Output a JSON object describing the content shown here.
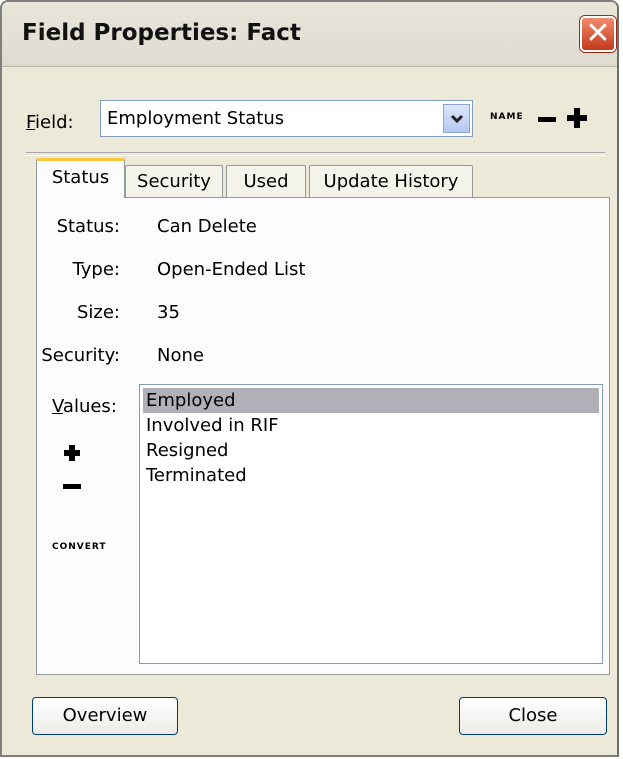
{
  "window": {
    "title": "Field Properties: Fact",
    "close_glyph": "✕"
  },
  "field": {
    "label_accel": "F",
    "label_rest": "ield:",
    "selected_value": "Employment Status",
    "name_button": "NAME",
    "remove_icon": "minus-icon",
    "add_icon": "plus-icon"
  },
  "tabs": [
    {
      "label": "Status",
      "active": true
    },
    {
      "label": "Security",
      "active": false
    },
    {
      "label": "Used",
      "active": false
    },
    {
      "label": "Update History",
      "active": false
    }
  ],
  "properties": {
    "status_label": "Status:",
    "status_value": "Can Delete",
    "type_label": "Type:",
    "type_value": "Open-Ended List",
    "size_label": "Size:",
    "size_value": "35",
    "security_label": "Security:",
    "security_value": "None"
  },
  "values": {
    "label_accel": "V",
    "label_rest": "alues:",
    "convert_button": "CONVERT",
    "items": [
      "Employed",
      "Involved in RIF",
      "Resigned",
      "Terminated"
    ],
    "selected_index": 0
  },
  "buttons": {
    "overview": "Overview",
    "close": "Close"
  },
  "colors": {
    "dialog_bg": "#ece9d8",
    "active_tab_accent": "#ffc73c",
    "selection_bg": "#b0b0b8",
    "close_button": "#c2391b"
  }
}
